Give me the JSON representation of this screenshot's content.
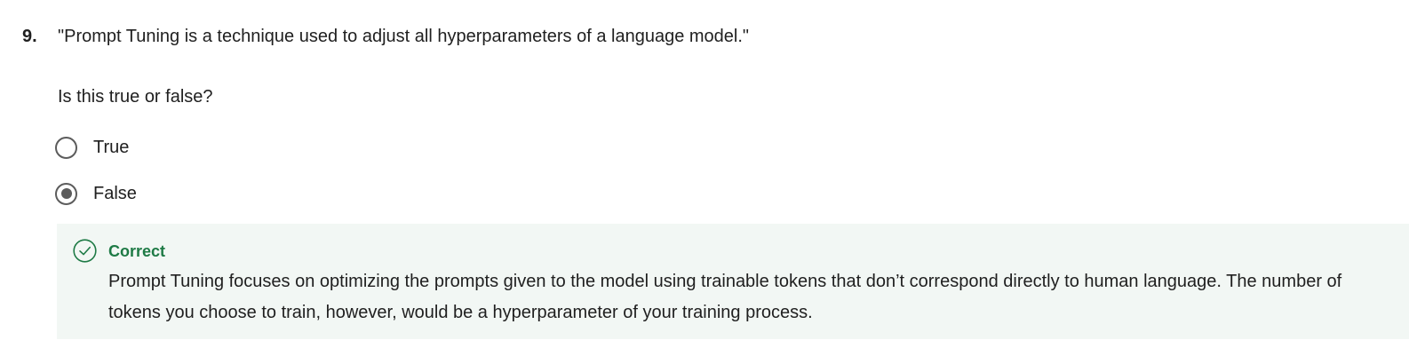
{
  "question": {
    "number": "9.",
    "text": "\"Prompt Tuning is a technique used to adjust all hyperparameters of a language model.\"",
    "prompt": "Is this true or false?"
  },
  "options": [
    {
      "label": "True",
      "selected": false
    },
    {
      "label": "False",
      "selected": true
    }
  ],
  "feedback": {
    "status": "Correct",
    "icon": "check-circle-icon",
    "accent_color": "#1e7a45",
    "background_color": "#f2f7f4",
    "text": "Prompt Tuning focuses on optimizing the prompts given to the model using trainable tokens that don’t correspond directly to human language.  The number of tokens you choose to train, however, would be a hyperparameter of your training process."
  }
}
